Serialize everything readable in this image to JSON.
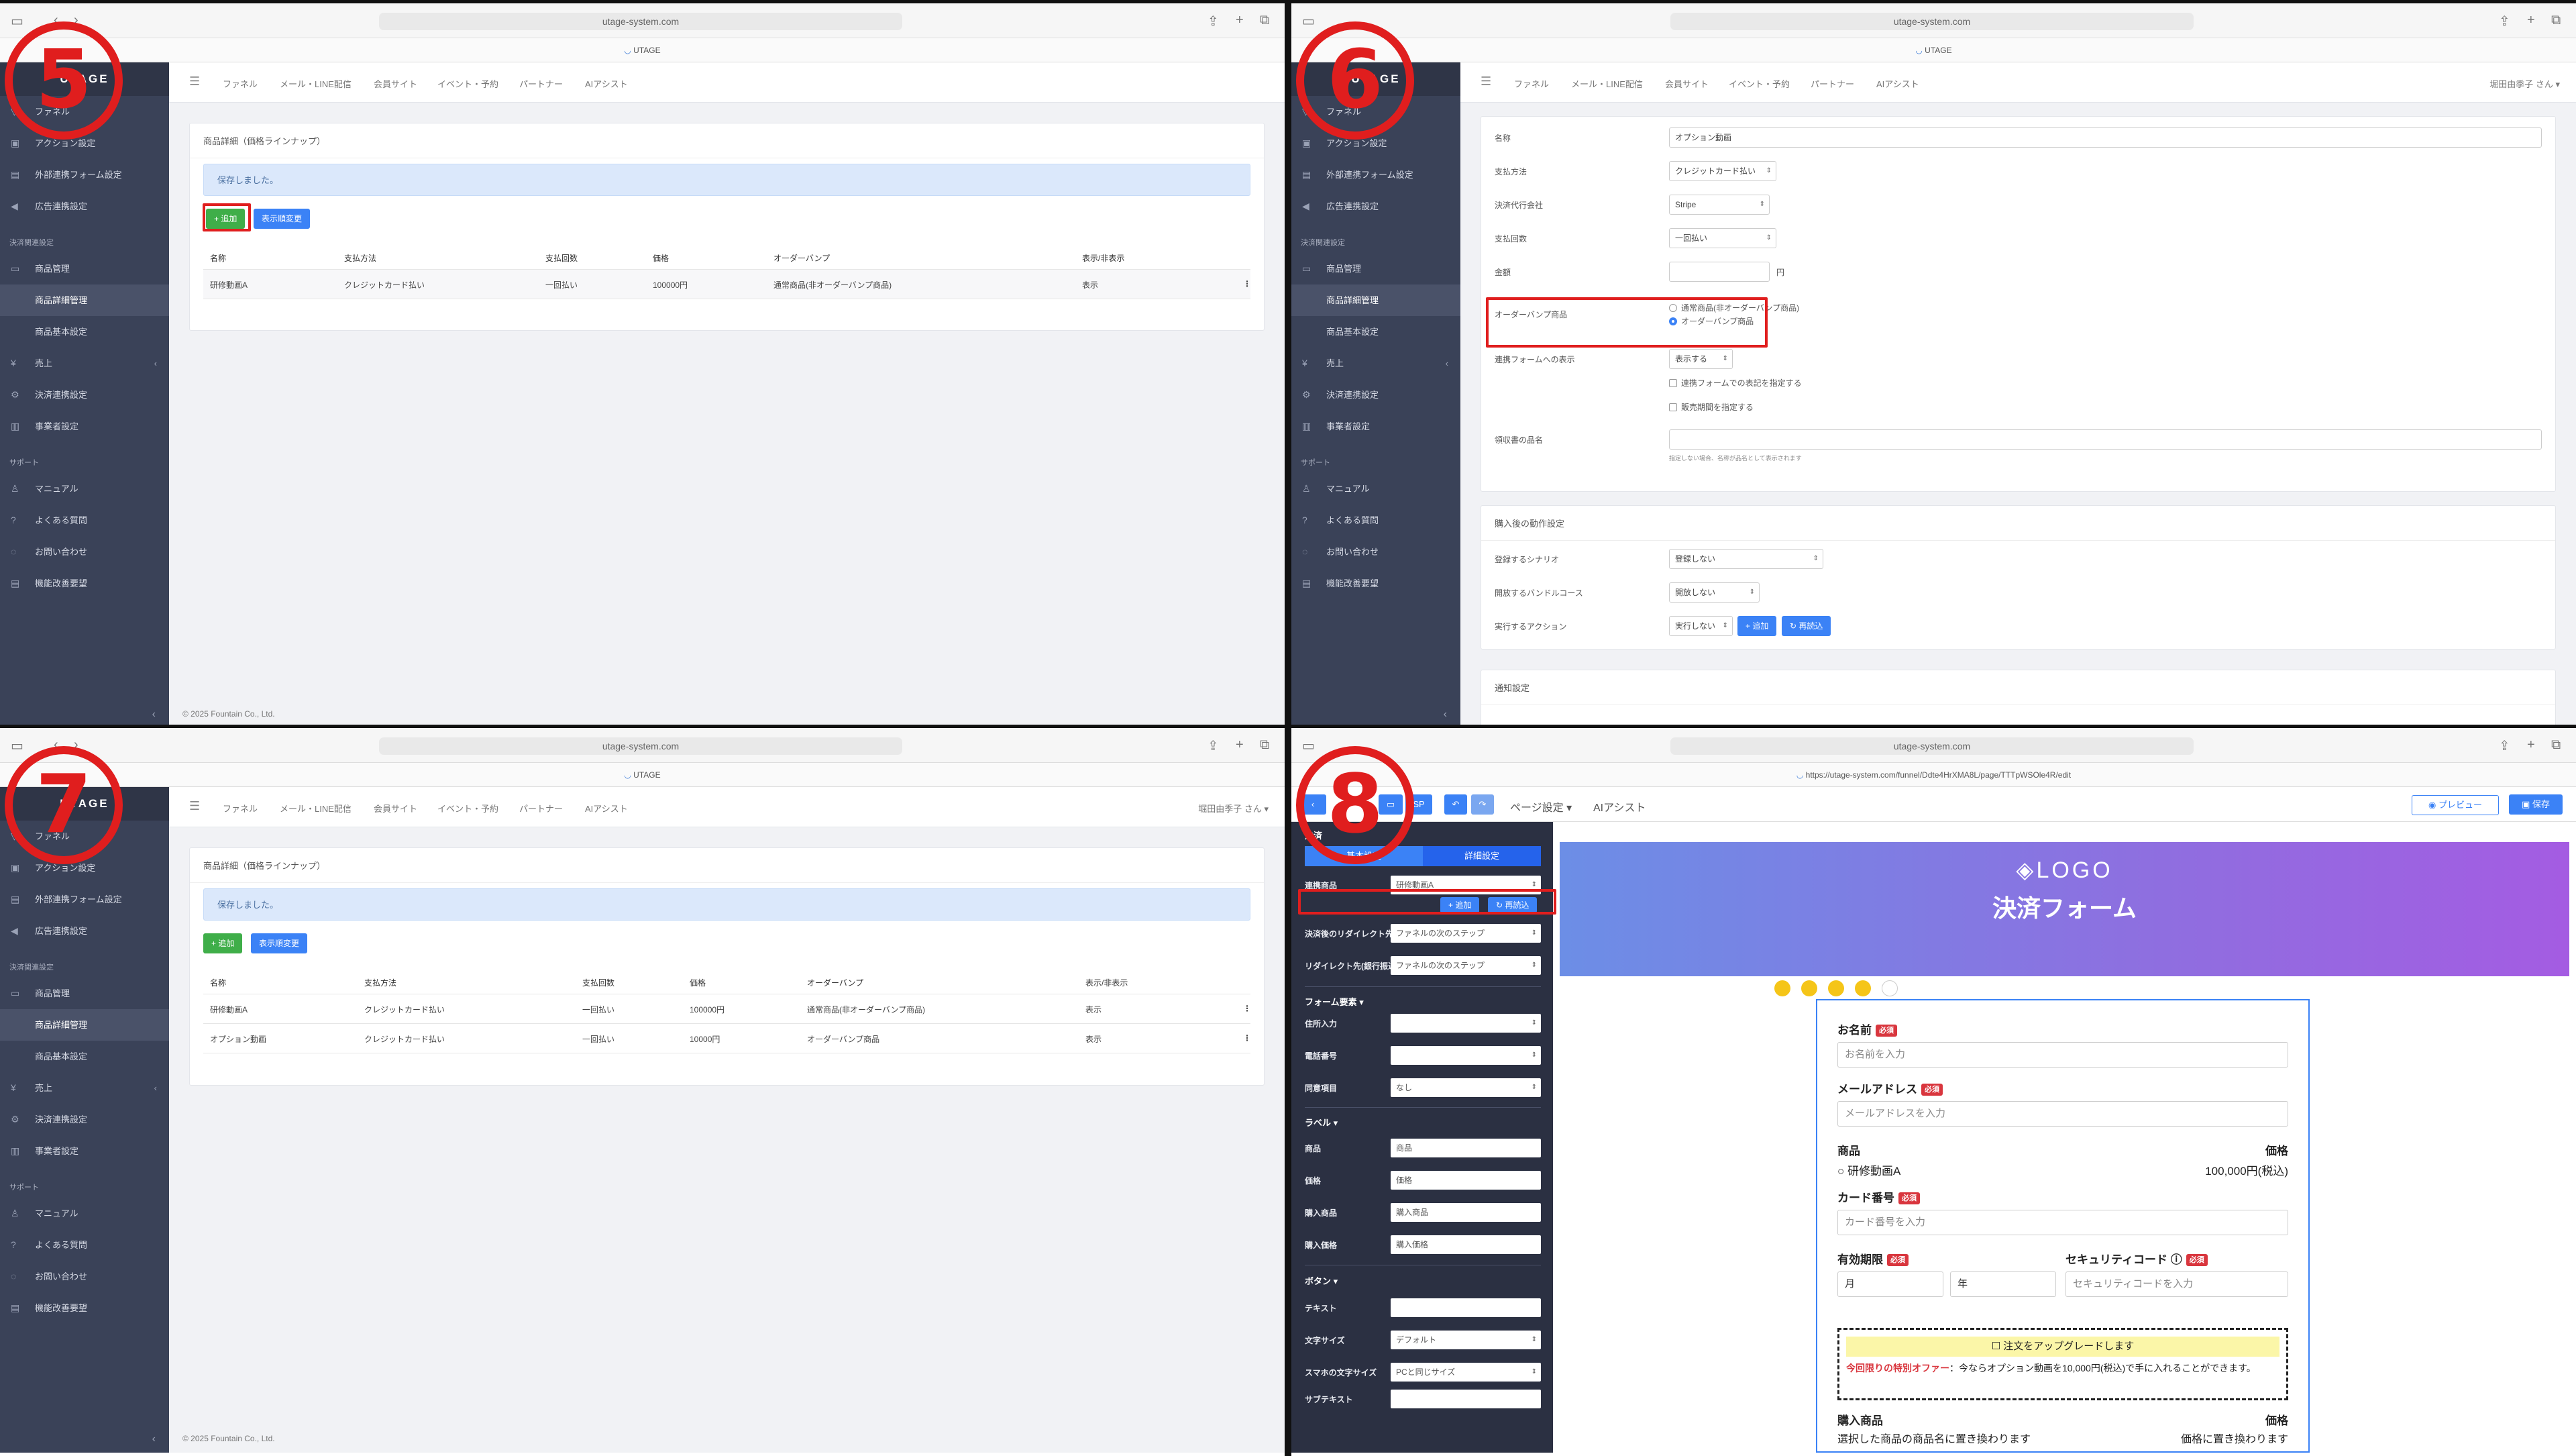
{
  "browser": {
    "url": "utage-system.com",
    "site_label": "UTAGE",
    "editor_url": "https://utage-system.com/funnel/Ddte4HrXMA8L/page/TTTpWSOle4R/edit"
  },
  "steps": [
    "5",
    "6",
    "7",
    "8"
  ],
  "app": {
    "brand": "UTAGE",
    "nav": [
      "ファネル",
      "メール・LINE配信",
      "会員サイト",
      "イベント・予約",
      "パートナー",
      "AIアシスト"
    ],
    "user": "堀田由季子 さん ▾",
    "footer": "© 2025 Fountain Co., Ltd.",
    "sidebar": {
      "top_items": [
        "ファネル",
        "アクション設定",
        "外部連携フォーム設定",
        "広告連携設定"
      ],
      "section_payment": "決済関連設定",
      "payment_items": [
        "商品管理",
        "商品詳細管理",
        "商品基本設定",
        "売上",
        "決済連携設定",
        "事業者設定"
      ],
      "section_support": "サポート",
      "support_items": [
        "マニュアル",
        "よくある質問",
        "お問い合わせ",
        "機能改善要望"
      ]
    }
  },
  "q5": {
    "card_title": "商品詳細（価格ラインナップ）",
    "alert": "保存しました。",
    "add_button": "+ 追加",
    "order_button": "表示順変更",
    "columns": [
      "名称",
      "支払方法",
      "支払回数",
      "価格",
      "オーダーバンプ",
      "表示/非表示"
    ],
    "rows": [
      [
        "研修動画A",
        "クレジットカード払い",
        "一回払い",
        "100000円",
        "通常商品(非オーダーバンプ商品)",
        "表示"
      ]
    ]
  },
  "q6": {
    "fields": {
      "name_label": "名称",
      "name_value": "オプション動画",
      "pay_method_label": "支払方法",
      "pay_method_value": "クレジットカード払い",
      "agent_label": "決済代行会社",
      "agent_value": "Stripe",
      "count_label": "支払回数",
      "count_value": "一回払い",
      "amount_label": "金額",
      "amount_unit": "円",
      "bump_label": "オーダーバンプ商品",
      "bump_opt1": "通常商品(非オーダーバンプ商品)",
      "bump_opt2": "オーダーバンプ商品",
      "display_label": "連携フォームへの表示",
      "display_value": "表示する",
      "check1": "連携フォームでの表記を指定する",
      "check2": "販売期間を指定する",
      "receipt_label": "領収書の品名",
      "receipt_hint": "指定しない場合、名称が品名として表示されます"
    },
    "after_section": "購入後の動作設定",
    "scenario_label": "登録するシナリオ",
    "scenario_value": "登録しない",
    "bundle_label": "開放するバンドルコース",
    "bundle_value": "開放しない",
    "action_label": "実行するアクション",
    "action_value": "実行しない",
    "add_button": "+ 追加",
    "reload_button": "再読込",
    "notify_section": "通知設定"
  },
  "q7": {
    "card_title": "商品詳細（価格ラインナップ）",
    "alert": "保存しました。",
    "add_button": "+ 追加",
    "order_button": "表示順変更",
    "columns": [
      "名称",
      "支払方法",
      "支払回数",
      "価格",
      "オーダーバンプ",
      "表示/非表示"
    ],
    "rows": [
      [
        "研修動画A",
        "クレジットカード払い",
        "一回払い",
        "100000円",
        "通常商品(非オーダーバンプ商品)",
        "表示"
      ],
      [
        "オプション動画",
        "クレジットカード払い",
        "一回払い",
        "10000円",
        "オーダーバンプ商品",
        "表示"
      ]
    ]
  },
  "q8": {
    "toolbar": {
      "sp": "SP",
      "page_settings": "ページ設定 ▾",
      "ai": "AIアシスト",
      "preview": "プレビュー",
      "save": "保存"
    },
    "panel": {
      "title": "決済",
      "tab_basic": "基本設定",
      "tab_detail": "詳細設定",
      "linked_product_label": "連携商品",
      "linked_product_value": "研修動画A",
      "add": "+ 追加",
      "reload": "再読込",
      "redirect_label": "決済後のリダイレクト先",
      "redirect_value": "ファネルの次のステップ",
      "redirect_bank_label": "リダイレクト先(銀行振込)",
      "redirect_bank_value": "ファネルの次のステップ",
      "form_section": "フォーム要素 ▾",
      "address_label": "住所入力",
      "phone_label": "電話番号",
      "consent_label": "同意項目",
      "consent_value": "なし",
      "label_section": "ラベル ▾",
      "lbl_product": "商品",
      "lbl_product_v": "商品",
      "lbl_price": "価格",
      "lbl_price_v": "価格",
      "lbl_bought": "購入商品",
      "lbl_bought_v": "購入商品",
      "lbl_bought_price": "購入価格",
      "lbl_bought_price_v": "購入価格",
      "button_section": "ボタン ▾",
      "btn_text": "テキスト",
      "btn_size": "文字サイズ",
      "btn_size_v": "デフォルト",
      "btn_sp_size": "スマホの文字サイズ",
      "btn_sp_size_v": "PCと同じサイズ",
      "btn_sub": "サブテキスト"
    },
    "canvas": {
      "logo": "◈LOGO",
      "form_title": "決済フォーム",
      "name_label": "お名前",
      "name_ph": "お名前を入力",
      "email_label": "メールアドレス",
      "email_ph": "メールアドレスを入力",
      "required": "必須",
      "product_col": "商品",
      "price_col": "価格",
      "product_name": "研修動画A",
      "product_price": "100,000円(税込)",
      "card_label": "カード番号",
      "card_ph": "カード番号を入力",
      "expiry_label": "有効期限",
      "month": "月",
      "year": "年",
      "cvc_label": "セキュリティコード",
      "cvc_ph": "セキュリティコードを入力",
      "upgrade_title": "注文をアップグレードします",
      "offer_lead": "今回限りの特別オファー",
      "offer_text": "：今ならオプション動画を10,000円(税込)で手に入れることができます。",
      "bought_col": "購入商品",
      "bought_price_col": "価格",
      "bought_name": "選択した商品の商品名に置き換わります",
      "bought_price": "価格に置き換わります"
    }
  }
}
